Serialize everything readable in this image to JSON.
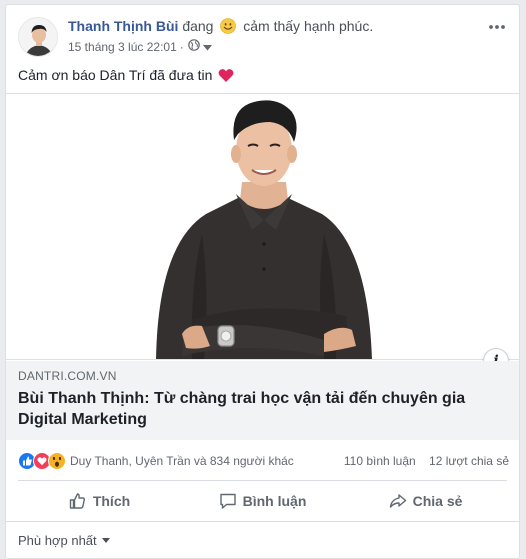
{
  "post": {
    "author": "Thanh Thịnh Bùi",
    "feeling_prefix": "đang",
    "feeling_text": "cảm thấy hạnh phúc.",
    "timestamp": "15 tháng 3 lúc 22:01",
    "separator": "·",
    "message": "Cảm ơn báo Dân Trí đã đưa tin",
    "privacy_icon": "globe-icon",
    "feeling_icon": "smile-emoji-icon",
    "message_icon": "heart-icon"
  },
  "link": {
    "domain": "DANTRI.COM.VN",
    "title": "Bùi Thanh Thịnh: Từ chàng trai học vận tải đến chuyên gia Digital Marketing",
    "info_label": "i"
  },
  "reactions": {
    "icons": [
      "like-reaction-icon",
      "love-reaction-icon",
      "wow-reaction-icon"
    ],
    "names": "Duy Thanh, Uyên Trần và 834 người khác",
    "comments": "110 bình luận",
    "shares": "12 lượt chia sẻ"
  },
  "actions": {
    "like": "Thích",
    "comment": "Bình luận",
    "share": "Chia sẻ"
  },
  "comments_sort": {
    "label": "Phù hợp nhất"
  },
  "colors": {
    "author": "#385898",
    "like_blue": "#1877f2",
    "love_red": "#f33e58",
    "wow_yellow": "#f7b125",
    "heart": "#e0245e"
  }
}
